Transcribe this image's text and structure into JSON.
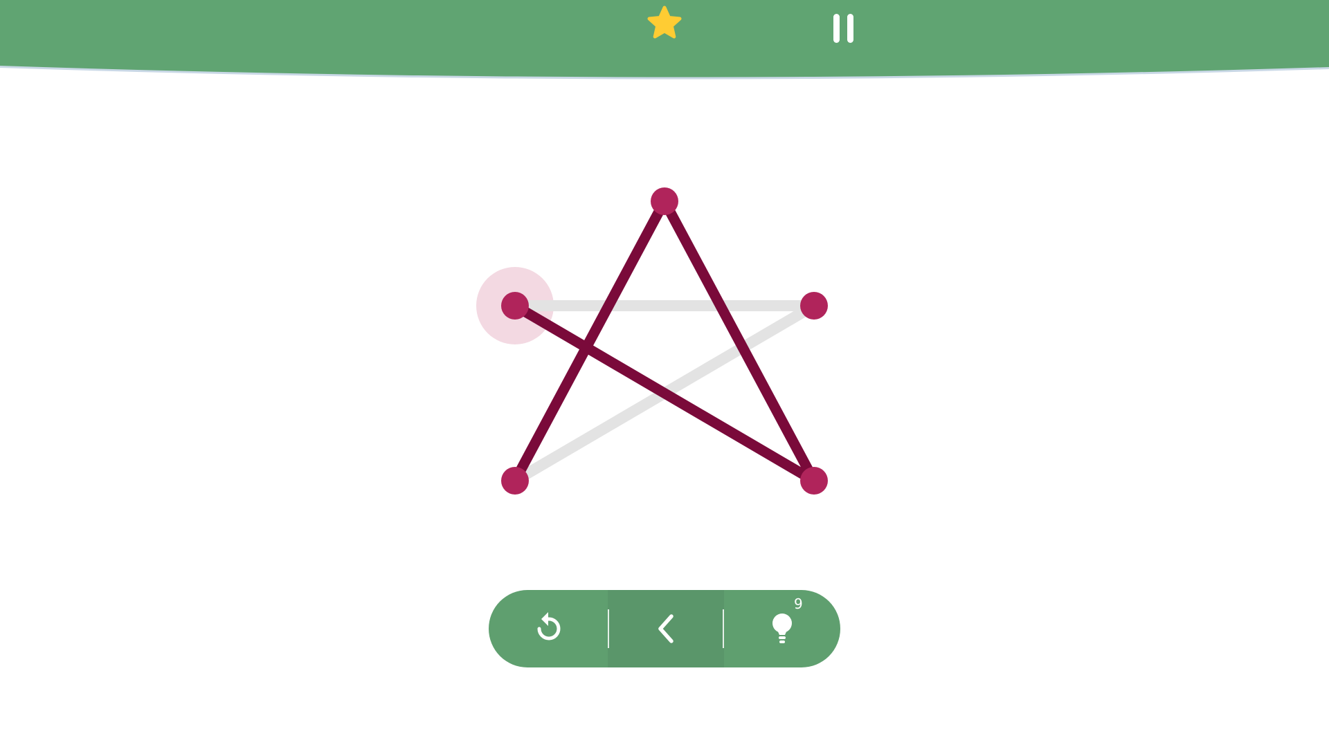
{
  "theme": {
    "header_color": "#60a472",
    "toolbar_color": "#5f9f6f",
    "node_color": "#b0245b",
    "line_done_color": "#7a0a3a",
    "line_pending_color": "#e3e3e3",
    "active_node_halo": "#f3d9e2",
    "star_color": "#ffcc33"
  },
  "header": {
    "star_icon": "star-icon",
    "pause_icon": "pause-icon"
  },
  "toolbar": {
    "restart_icon": "restart-icon",
    "undo_icon": "back-arrow-icon",
    "hint_icon": "lightbulb-icon",
    "hint_count": "9"
  },
  "puzzle": {
    "nodes": [
      {
        "id": "top",
        "active": false
      },
      {
        "id": "upper-left",
        "active": true
      },
      {
        "id": "upper-right",
        "active": false
      },
      {
        "id": "lower-left",
        "active": false
      },
      {
        "id": "lower-right",
        "active": false
      }
    ],
    "edges": [
      {
        "from": "upper-left",
        "to": "upper-right",
        "drawn": false
      },
      {
        "from": "upper-right",
        "to": "lower-left",
        "drawn": false
      },
      {
        "from": "lower-left",
        "to": "top",
        "drawn": true
      },
      {
        "from": "top",
        "to": "lower-right",
        "drawn": true
      },
      {
        "from": "lower-right",
        "to": "upper-left",
        "drawn": true
      }
    ]
  }
}
